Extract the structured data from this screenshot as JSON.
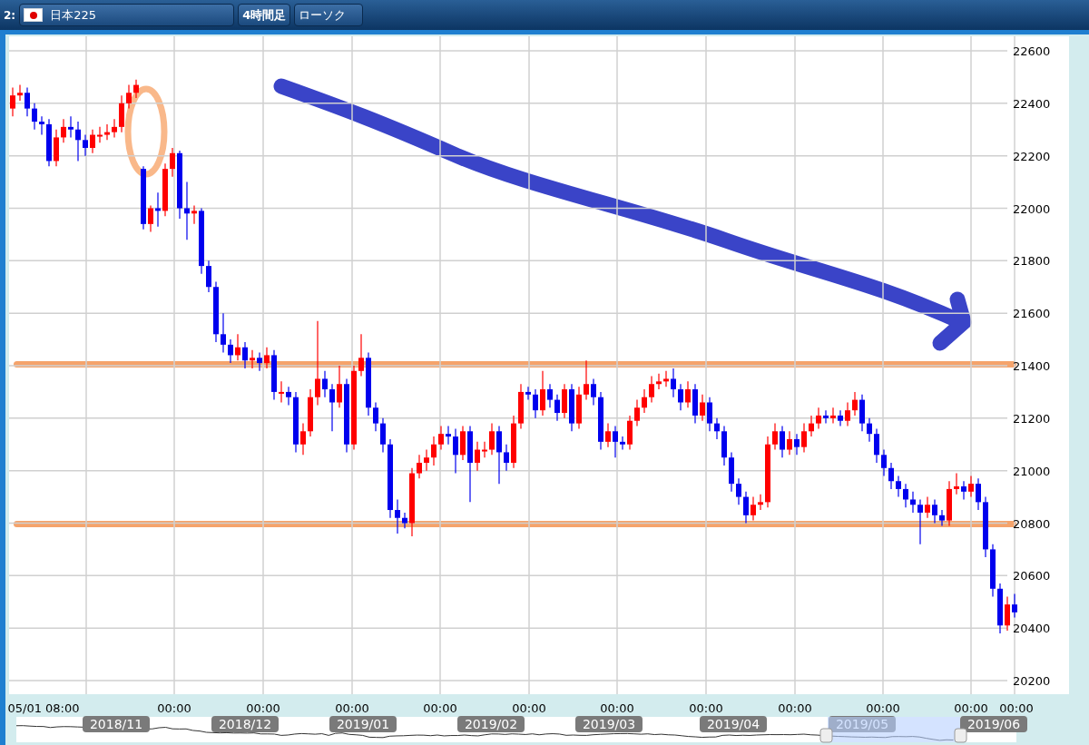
{
  "header": {
    "panel_number": "2:",
    "symbol": "日本225",
    "timeframe": "4時間足",
    "chart_type": "ローソク"
  },
  "price_axis": [
    "22600",
    "22400",
    "22200",
    "22000",
    "21800",
    "21600",
    "21400",
    "21200",
    "21000",
    "20800",
    "20600",
    "20400",
    "20200"
  ],
  "chart_data": {
    "type": "candlestick",
    "ylim": [
      20200,
      22600
    ],
    "grid": true,
    "yticks": [
      22600,
      22400,
      22200,
      22000,
      21800,
      21600,
      21400,
      21200,
      21000,
      20800,
      20600,
      20400,
      20200
    ],
    "ohlc": [
      [
        22380,
        22460,
        22350,
        22430
      ],
      [
        22430,
        22470,
        22410,
        22440
      ],
      [
        22440,
        22460,
        22350,
        22380
      ],
      [
        22380,
        22400,
        22300,
        22330
      ],
      [
        22330,
        22350,
        22280,
        22320
      ],
      [
        22320,
        22340,
        22160,
        22180
      ],
      [
        22180,
        22300,
        22160,
        22270
      ],
      [
        22270,
        22340,
        22250,
        22310
      ],
      [
        22310,
        22350,
        22270,
        22300
      ],
      [
        22300,
        22330,
        22180,
        22260
      ],
      [
        22260,
        22280,
        22200,
        22230
      ],
      [
        22230,
        22300,
        22210,
        22280
      ],
      [
        22280,
        22310,
        22250,
        22280
      ],
      [
        22280,
        22320,
        22260,
        22290
      ],
      [
        22290,
        22340,
        22270,
        22310
      ],
      [
        22310,
        22430,
        22290,
        22400
      ],
      [
        22400,
        22470,
        22380,
        22440
      ],
      [
        22440,
        22490,
        22420,
        22470
      ],
      [
        22150,
        22160,
        21920,
        21940
      ],
      [
        21940,
        22010,
        21910,
        22000
      ],
      [
        22000,
        22060,
        21930,
        21990
      ],
      [
        21990,
        22170,
        21970,
        22150
      ],
      [
        22150,
        22230,
        22120,
        22210
      ],
      [
        22210,
        22220,
        21960,
        22000
      ],
      [
        22000,
        22100,
        21880,
        21980
      ],
      [
        21980,
        22010,
        21940,
        21990
      ],
      [
        21990,
        22000,
        21750,
        21780
      ],
      [
        21780,
        21800,
        21680,
        21700
      ],
      [
        21700,
        21720,
        21490,
        21520
      ],
      [
        21520,
        21600,
        21450,
        21480
      ],
      [
        21480,
        21500,
        21410,
        21440
      ],
      [
        21440,
        21520,
        21420,
        21470
      ],
      [
        21470,
        21490,
        21390,
        21420
      ],
      [
        21420,
        21460,
        21390,
        21430
      ],
      [
        21430,
        21450,
        21380,
        21410
      ],
      [
        21410,
        21470,
        21390,
        21440
      ],
      [
        21440,
        21460,
        21270,
        21300
      ],
      [
        21300,
        21340,
        21260,
        21300
      ],
      [
        21300,
        21320,
        21250,
        21280
      ],
      [
        21280,
        21300,
        21070,
        21100
      ],
      [
        21100,
        21180,
        21060,
        21150
      ],
      [
        21150,
        21310,
        21130,
        21280
      ],
      [
        21280,
        21570,
        21250,
        21350
      ],
      [
        21350,
        21380,
        21280,
        21310
      ],
      [
        21310,
        21330,
        21150,
        21260
      ],
      [
        21260,
        21400,
        21240,
        21330
      ],
      [
        21330,
        21350,
        21070,
        21100
      ],
      [
        21100,
        21400,
        21080,
        21380
      ],
      [
        21380,
        21520,
        21360,
        21430
      ],
      [
        21430,
        21450,
        21210,
        21240
      ],
      [
        21240,
        21260,
        21150,
        21180
      ],
      [
        21180,
        21200,
        21070,
        21100
      ],
      [
        21100,
        21120,
        20820,
        20850
      ],
      [
        20850,
        20890,
        20760,
        20820
      ],
      [
        20820,
        20840,
        20780,
        20800
      ],
      [
        20800,
        21010,
        20750,
        20990
      ],
      [
        20990,
        21060,
        20970,
        21030
      ],
      [
        21030,
        21080,
        21000,
        21050
      ],
      [
        21050,
        21130,
        21020,
        21100
      ],
      [
        21100,
        21170,
        21080,
        21140
      ],
      [
        21140,
        21170,
        21100,
        21130
      ],
      [
        21130,
        21160,
        20990,
        21060
      ],
      [
        21060,
        21170,
        21040,
        21150
      ],
      [
        21150,
        21170,
        20880,
        21030
      ],
      [
        21030,
        21110,
        21000,
        21080
      ],
      [
        21080,
        21110,
        21050,
        21080
      ],
      [
        21080,
        21180,
        21060,
        21150
      ],
      [
        21150,
        21170,
        20950,
        21070
      ],
      [
        21070,
        21100,
        21000,
        21030
      ],
      [
        21030,
        21210,
        21010,
        21180
      ],
      [
        21180,
        21330,
        21160,
        21300
      ],
      [
        21300,
        21320,
        21270,
        21290
      ],
      [
        21290,
        21310,
        21200,
        21230
      ],
      [
        21230,
        21380,
        21210,
        21310
      ],
      [
        21310,
        21330,
        21240,
        21270
      ],
      [
        21270,
        21290,
        21190,
        21220
      ],
      [
        21220,
        21330,
        21200,
        21310
      ],
      [
        21310,
        21330,
        21150,
        21180
      ],
      [
        21180,
        21320,
        21160,
        21290
      ],
      [
        21290,
        21420,
        21270,
        21330
      ],
      [
        21330,
        21350,
        21250,
        21280
      ],
      [
        21280,
        21300,
        21080,
        21110
      ],
      [
        21110,
        21180,
        21090,
        21150
      ],
      [
        21150,
        21170,
        21050,
        21110
      ],
      [
        21110,
        21130,
        21080,
        21100
      ],
      [
        21100,
        21210,
        21080,
        21190
      ],
      [
        21190,
        21270,
        21170,
        21240
      ],
      [
        21240,
        21310,
        21220,
        21280
      ],
      [
        21280,
        21360,
        21260,
        21330
      ],
      [
        21330,
        21370,
        21310,
        21340
      ],
      [
        21340,
        21380,
        21320,
        21350
      ],
      [
        21350,
        21390,
        21280,
        21310
      ],
      [
        21310,
        21330,
        21230,
        21260
      ],
      [
        21260,
        21340,
        21240,
        21310
      ],
      [
        21310,
        21330,
        21180,
        21210
      ],
      [
        21210,
        21290,
        21190,
        21260
      ],
      [
        21260,
        21280,
        21150,
        21180
      ],
      [
        21180,
        21200,
        21120,
        21150
      ],
      [
        21150,
        21170,
        21020,
        21050
      ],
      [
        21050,
        21070,
        20920,
        20950
      ],
      [
        20950,
        20970,
        20870,
        20900
      ],
      [
        20900,
        20920,
        20800,
        20830
      ],
      [
        20830,
        20900,
        20810,
        20870
      ],
      [
        20870,
        20910,
        20850,
        20880
      ],
      [
        20880,
        21130,
        20860,
        21100
      ],
      [
        21100,
        21180,
        21080,
        21150
      ],
      [
        21150,
        21170,
        21050,
        21080
      ],
      [
        21080,
        21150,
        21060,
        21120
      ],
      [
        21120,
        21140,
        21060,
        21090
      ],
      [
        21090,
        21180,
        21070,
        21150
      ],
      [
        21150,
        21210,
        21130,
        21180
      ],
      [
        21180,
        21240,
        21160,
        21210
      ],
      [
        21210,
        21230,
        21180,
        21200
      ],
      [
        21200,
        21240,
        21180,
        21210
      ],
      [
        21210,
        21230,
        21170,
        21190
      ],
      [
        21190,
        21260,
        21170,
        21230
      ],
      [
        21230,
        21300,
        21210,
        21270
      ],
      [
        21270,
        21290,
        21150,
        21180
      ],
      [
        21180,
        21200,
        21110,
        21140
      ],
      [
        21140,
        21160,
        21030,
        21060
      ],
      [
        21060,
        21080,
        20980,
        21010
      ],
      [
        21010,
        21030,
        20930,
        20960
      ],
      [
        20960,
        20980,
        20900,
        20930
      ],
      [
        20930,
        20950,
        20860,
        20890
      ],
      [
        20890,
        20920,
        20840,
        20870
      ],
      [
        20870,
        20890,
        20720,
        20840
      ],
      [
        20840,
        20900,
        20820,
        20870
      ],
      [
        20870,
        20890,
        20800,
        20830
      ],
      [
        20830,
        20850,
        20790,
        20810
      ],
      [
        20810,
        20960,
        20790,
        20930
      ],
      [
        20930,
        20990,
        20910,
        20940
      ],
      [
        20940,
        20960,
        20890,
        20920
      ],
      [
        20920,
        20980,
        20900,
        20950
      ],
      [
        20950,
        20970,
        20850,
        20880
      ],
      [
        20880,
        20900,
        20670,
        20700
      ],
      [
        20700,
        20720,
        20520,
        20550
      ],
      [
        20550,
        20570,
        20380,
        20410
      ],
      [
        20410,
        20520,
        20390,
        20490
      ],
      [
        20490,
        20530,
        20440,
        20460
      ]
    ]
  },
  "time_axis": [
    "05/01 08:00",
    "00:00",
    "00:00",
    "00:00",
    "00:00",
    "00:00",
    "00:00",
    "00:00",
    "00:00",
    "00:00",
    "00:00",
    "00:00"
  ],
  "navigator": {
    "months": [
      "2018/11",
      "2018/12",
      "2019/01",
      "2019/02",
      "2019/03",
      "2019/04",
      "2019/05",
      "2019/06"
    ]
  }
}
